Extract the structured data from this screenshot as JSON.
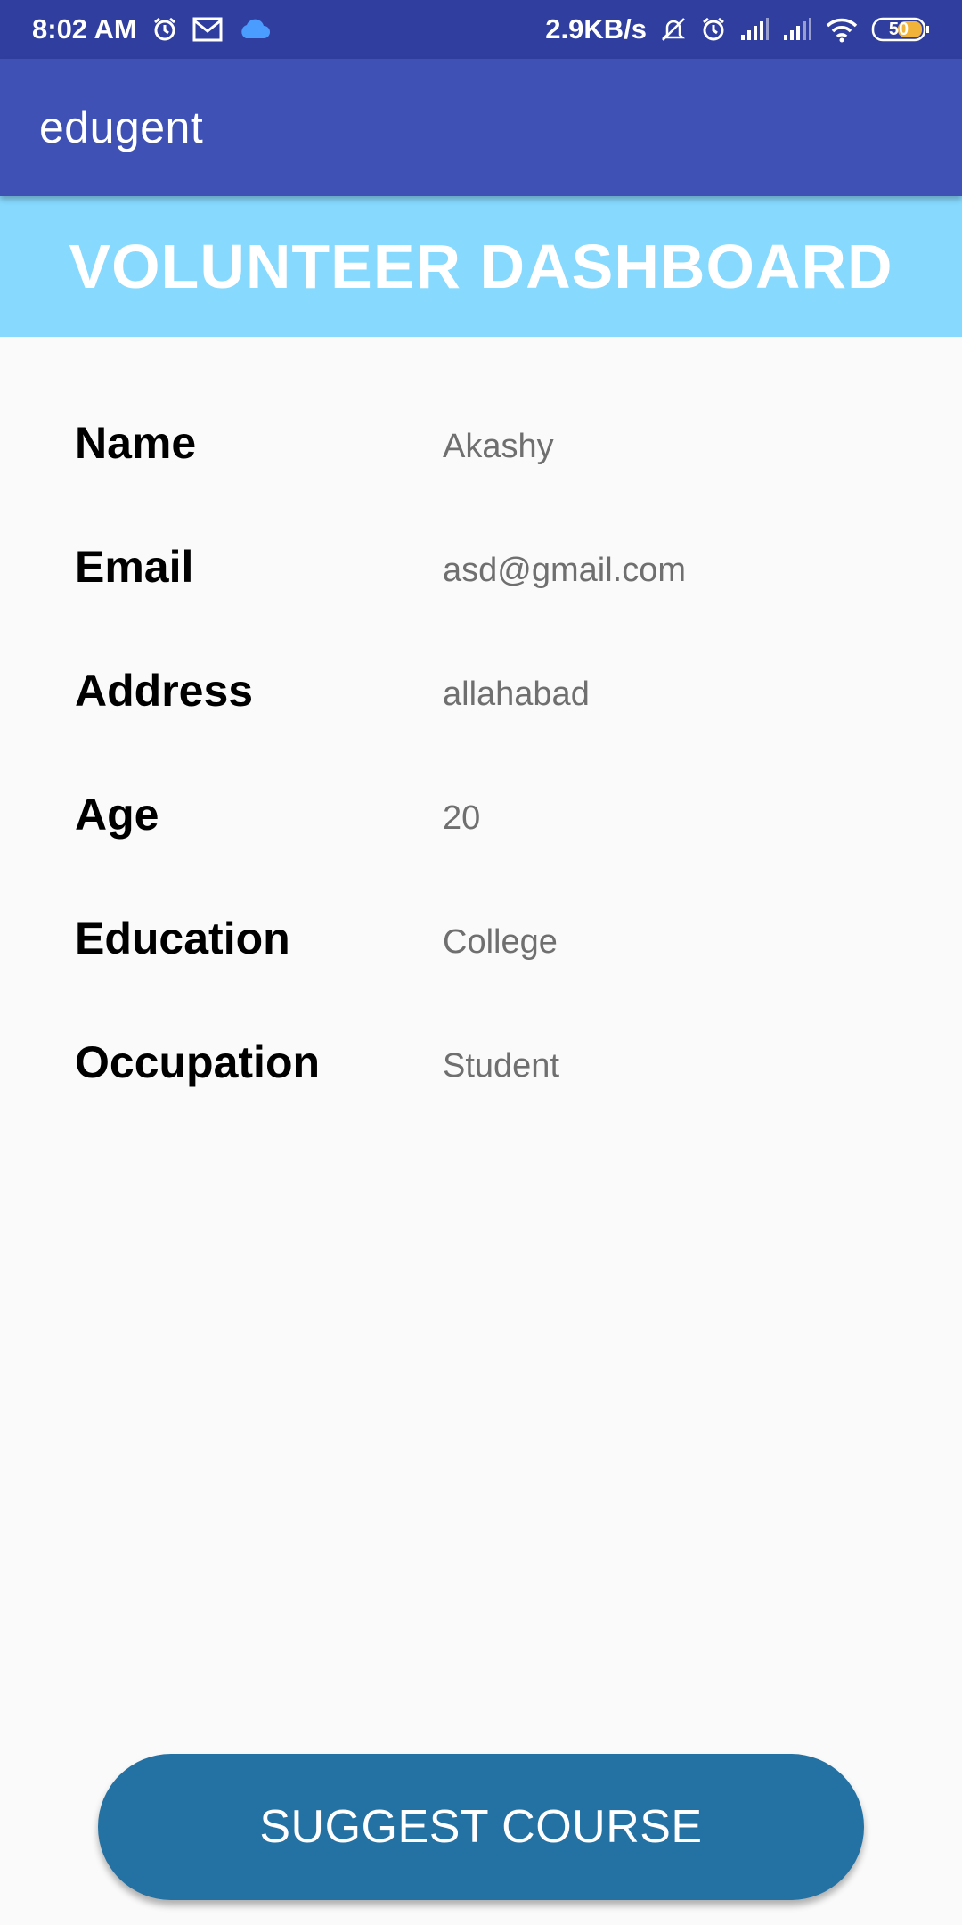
{
  "status_bar": {
    "time": "8:02 AM",
    "network_speed": "2.9KB/s",
    "battery_level": "50",
    "left_icons": [
      "alarm-icon",
      "gmail-icon",
      "cloud-icon"
    ],
    "right_icons": [
      "mute-notification-icon",
      "alarm-icon",
      "signal-icon",
      "signal-icon",
      "wifi-icon",
      "battery-icon"
    ]
  },
  "app_bar": {
    "title": "edugent"
  },
  "banner": {
    "title": "VOLUNTEER DASHBOARD"
  },
  "profile": {
    "rows": [
      {
        "label": "Name",
        "value": "Akashy"
      },
      {
        "label": "Email",
        "value": "asd@gmail.com"
      },
      {
        "label": "Address",
        "value": "allahabad"
      },
      {
        "label": "Age",
        "value": "20"
      },
      {
        "label": "Education",
        "value": "College"
      },
      {
        "label": "Occupation",
        "value": "Student"
      }
    ]
  },
  "actions": {
    "suggest_course_label": "SUGGEST COURSE"
  },
  "colors": {
    "status_bar": "#303f9f",
    "app_bar": "#3f51b5",
    "banner": "#87d9fe",
    "button": "#2471a3",
    "background": "#fafafa",
    "value_text": "#6f6f6f"
  }
}
